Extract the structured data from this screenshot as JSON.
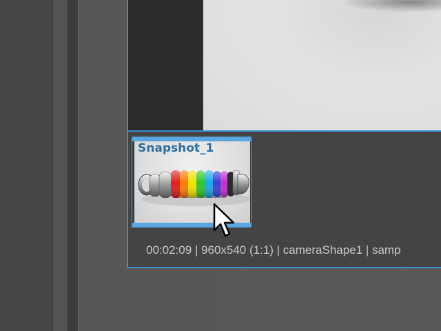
{
  "snapshot": {
    "title": "Snapshot_1"
  },
  "status_bar": {
    "text": "00:02:09 | 960x540 (1:1) | cameraShape1  | samp"
  },
  "colors": {
    "accent": "#3f8fc9",
    "snapshot_title": "#2f6f9f",
    "status_text": "#c8c8c8"
  },
  "icons": {
    "cursor": "arrow-cursor-icon"
  }
}
